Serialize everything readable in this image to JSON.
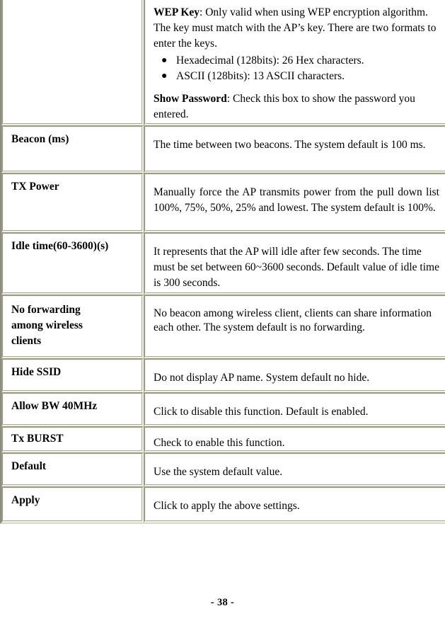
{
  "document": {
    "footer": "- 38 -"
  },
  "table": {
    "rows": [
      {
        "label": "",
        "kind": "wep-key",
        "paragraphs": [
          {
            "lead_bold": "WEP Key",
            "text": ": Only valid when using WEP encryption algorithm. The key must match with the AP’s key. There are two formats to enter the keys."
          }
        ],
        "bullets": [
          "Hexadecimal (128bits): 26 Hex characters.",
          "ASCII (128bits): 13 ASCII characters."
        ],
        "paragraphs2": [
          {
            "lead_bold": "Show Password",
            "text": ": Check this box to show the password you entered."
          }
        ]
      },
      {
        "label": "Beacon (ms)",
        "desc": "The time between two beacons. The system default is 100 ms."
      },
      {
        "label": "TX Power",
        "desc": "Manually force the AP transmits power from the pull down list 100%, 75%, 50%, 25% and lowest. The system default is 100%."
      },
      {
        "label": "Idle time(60-3600)(s)",
        "desc": "It represents that the AP will idle after few seconds. The time must be set between 60~3600 seconds. Default value of idle time is 300 seconds."
      },
      {
        "label": "No forwarding among wireless clients",
        "desc": "No beacon among wireless client, clients can share information each other. The system default is no forwarding."
      },
      {
        "label": "Hide SSID",
        "desc": "Do not display AP name. System default no hide."
      },
      {
        "label": "Allow BW 40MHz",
        "desc": "Click to disable this function. Default is enabled."
      },
      {
        "label": "Tx BURST",
        "desc": "Check to enable this function."
      },
      {
        "label": "Default",
        "desc": "Use the system default value."
      },
      {
        "label": "Apply",
        "desc": "Click to apply the above settings."
      }
    ]
  },
  "bullet_glyph": "●"
}
